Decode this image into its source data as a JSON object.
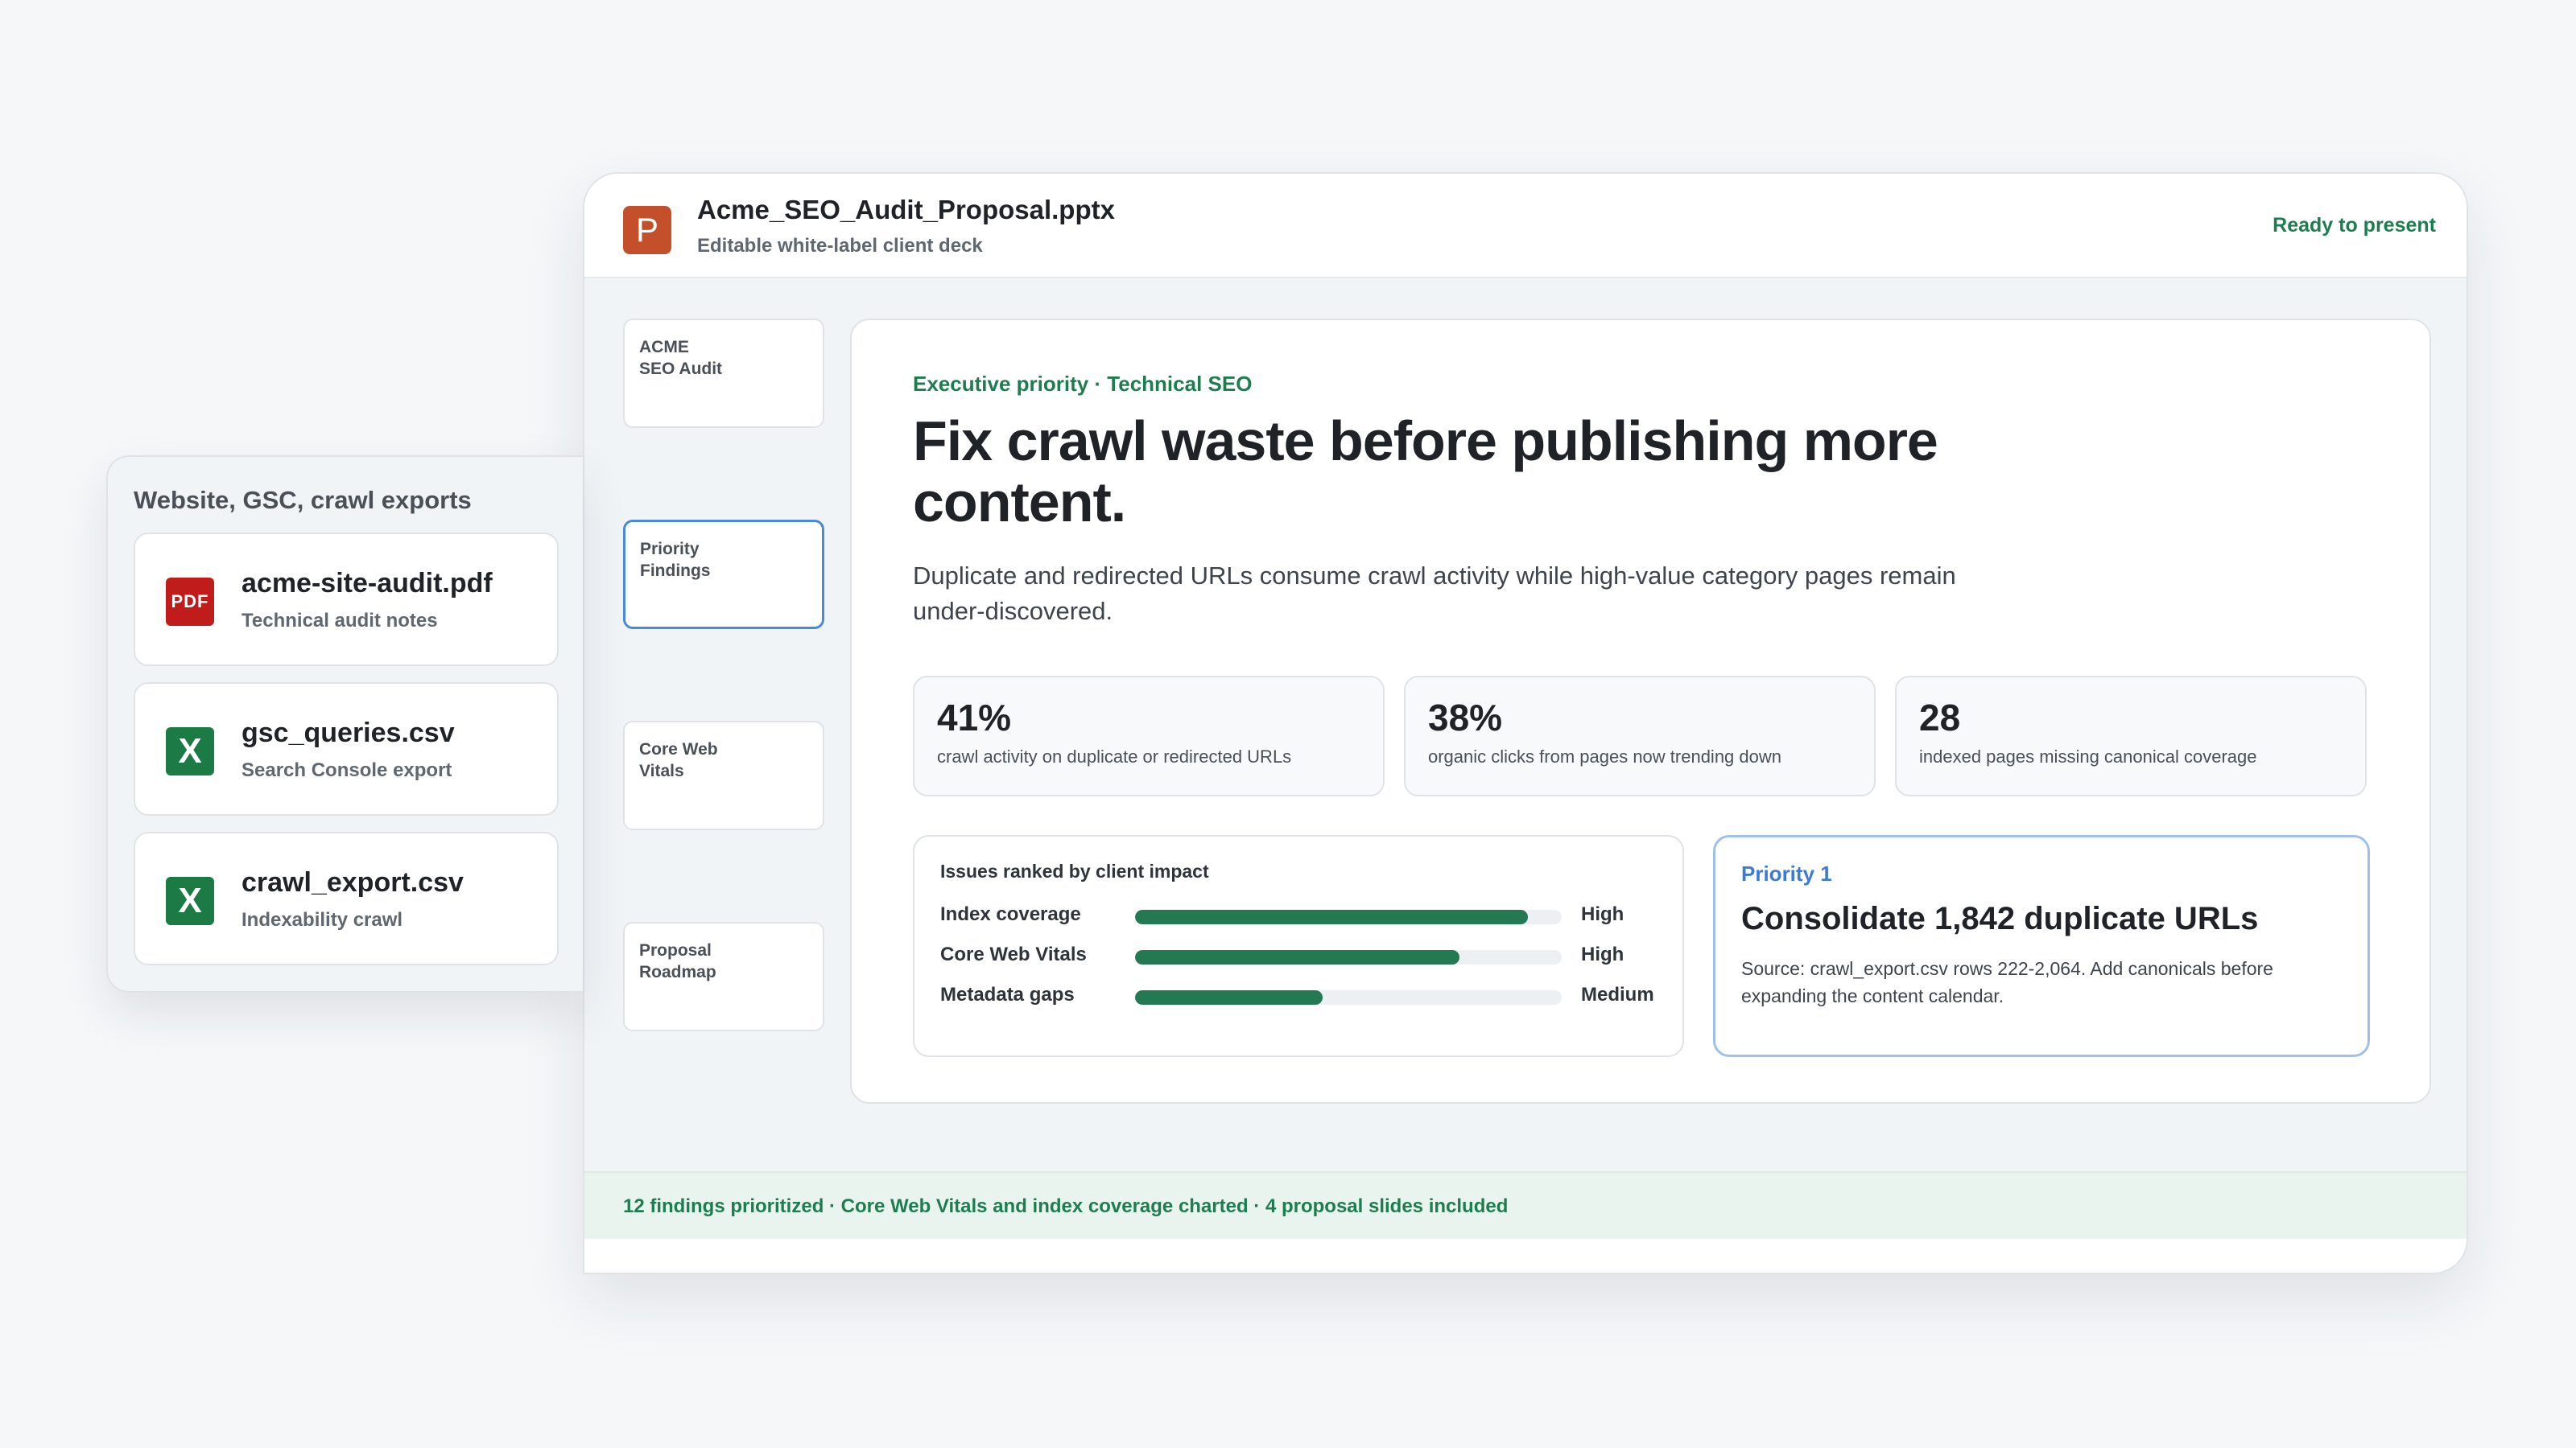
{
  "deck": {
    "filename": "Acme_SEO_Audit_Proposal.pptx",
    "subtitle": "Editable white-label client deck",
    "status": "Ready to present",
    "icon_letter": "P",
    "thumbnails": [
      {
        "line1": "ACME",
        "line2": "SEO Audit"
      },
      {
        "line1": "Priority",
        "line2": "Findings"
      },
      {
        "line1": "Core Web",
        "line2": "Vitals"
      },
      {
        "line1": "Proposal",
        "line2": "Roadmap"
      }
    ],
    "footer": "12 findings prioritized · Core Web Vitals and index coverage charted · 4 proposal slides included"
  },
  "slide": {
    "kicker": "Executive priority · Technical SEO",
    "title": "Fix crawl waste before publishing more content.",
    "description": "Duplicate and redirected URLs consume crawl activity while high-value category pages remain under-discovered.",
    "metrics": [
      {
        "value": "41%",
        "label": "crawl activity on duplicate or redirected URLs"
      },
      {
        "value": "38%",
        "label": "organic clicks from pages now trending down"
      },
      {
        "value": "28",
        "label": "indexed pages missing canonical coverage"
      }
    ],
    "issues": {
      "title": "Issues ranked by client impact",
      "rows": [
        {
          "label": "Index coverage",
          "fill": 0.92,
          "level": "High"
        },
        {
          "label": "Core Web Vitals",
          "fill": 0.76,
          "level": "High"
        },
        {
          "label": "Metadata gaps",
          "fill": 0.44,
          "level": "Medium"
        }
      ]
    },
    "priority": {
      "label": "Priority 1",
      "title": "Consolidate 1,842 duplicate URLs",
      "description": "Source: crawl_export.csv rows 222-2,064. Add canonicals before expanding the content calendar."
    }
  },
  "sources": {
    "title": "Website, GSC, crawl exports",
    "files": [
      {
        "name": "acme-site-audit.pdf",
        "desc": "Technical audit notes",
        "icon": "pdf-file-icon",
        "icon_text": "PDF"
      },
      {
        "name": "gsc_queries.csv",
        "desc": "Search Console export",
        "icon": "excel-file-icon",
        "icon_text": "X"
      },
      {
        "name": "crawl_export.csv",
        "desc": "Indexability crawl",
        "icon": "excel-file-icon",
        "icon_text": "X"
      }
    ]
  },
  "colors": {
    "accent_green": "#1e7d4f",
    "bar_green": "#237a52",
    "accent_blue": "#3b7bd6",
    "ppt_orange": "#c4502b",
    "pdf_red": "#c01c1c",
    "excel_green": "#1c7a44"
  }
}
